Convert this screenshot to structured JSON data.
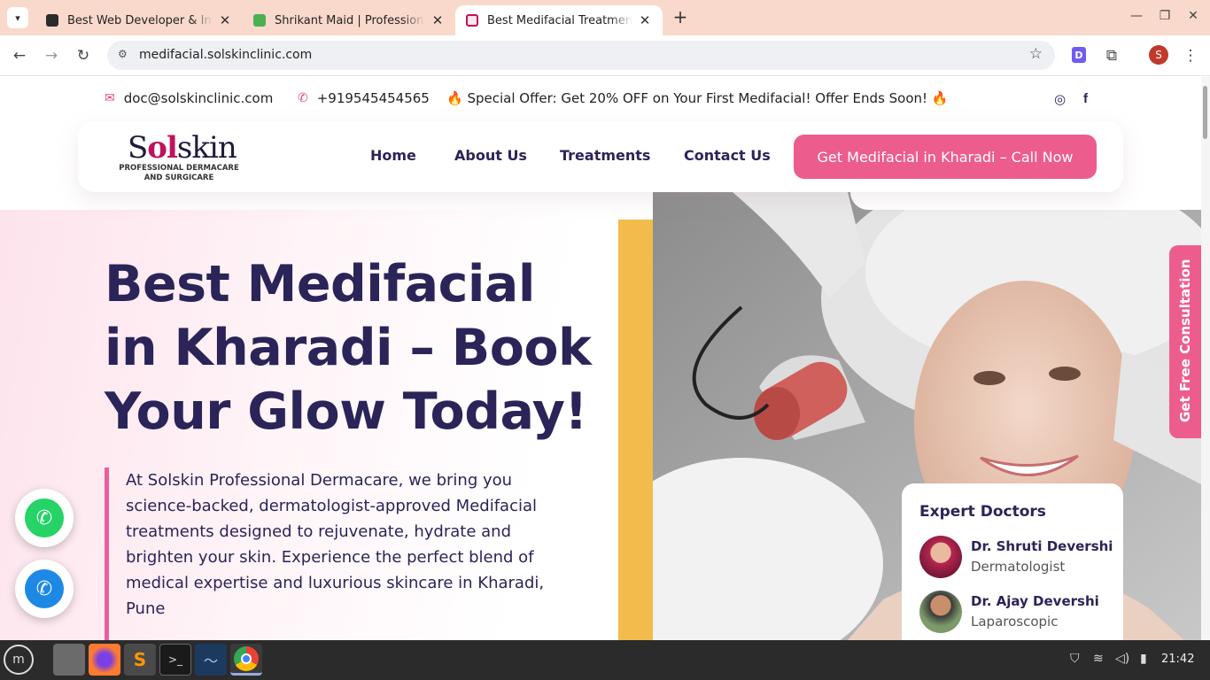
{
  "browser": {
    "tabs": [
      {
        "title": "Best Web Developer & Implementation",
        "favicon_color": "#2b2b2b",
        "active": false
      },
      {
        "title": "Shrikant Maid | Professional",
        "favicon_color": "#4caf50",
        "active": false
      },
      {
        "title": "Best Medifacial Treatment in Kharadi",
        "favicon_color": "#c0125b",
        "active": true
      }
    ],
    "url": "medifacial.solskinclinic.com",
    "profile_initial": "S",
    "extension_letter": "D"
  },
  "topbar": {
    "email": "doc@solskinclinic.com",
    "phone": "+919545454565",
    "offer": "🔥 Special Offer: Get 20% OFF on Your First Medifacial! Offer Ends Soon! 🔥"
  },
  "logo": {
    "brand_start": "S",
    "brand_accent": "ol",
    "brand_end": "skin",
    "tagline_line1": "PROFESSIONAL DERMACARE",
    "tagline_line2": "AND SURGICARE"
  },
  "nav": {
    "items": [
      "Home",
      "About Us",
      "Treatments",
      "Contact Us"
    ],
    "cta": "Get Medifacial in Kharadi – Call Now"
  },
  "hero": {
    "title": "Best Medifacial in Kharadi – Book Your Glow Today!",
    "description": "At Solskin Professional Dermacare, we bring you science-backed, dermatologist-approved Medifacial treatments designed to rejuvenate, hydrate and brighten your skin. Experience the perfect blend of medical expertise and luxurious skincare in Kharadi, Pune"
  },
  "side_tab": "Get Free Consultation",
  "doctors": {
    "heading": "Expert Doctors",
    "list": [
      {
        "name": "Dr. Shruti Devershi",
        "role": "Dermatologist"
      },
      {
        "name": "Dr. Ajay Devershi",
        "role": "Laparoscopic"
      }
    ]
  },
  "taskbar": {
    "time": "21:42"
  },
  "colors": {
    "primary": "#2a2458",
    "accent_pink": "#ec5d8d",
    "yellow": "#f2bb4c",
    "whatsapp": "#25d366",
    "phone_fab": "#1e88e5"
  }
}
